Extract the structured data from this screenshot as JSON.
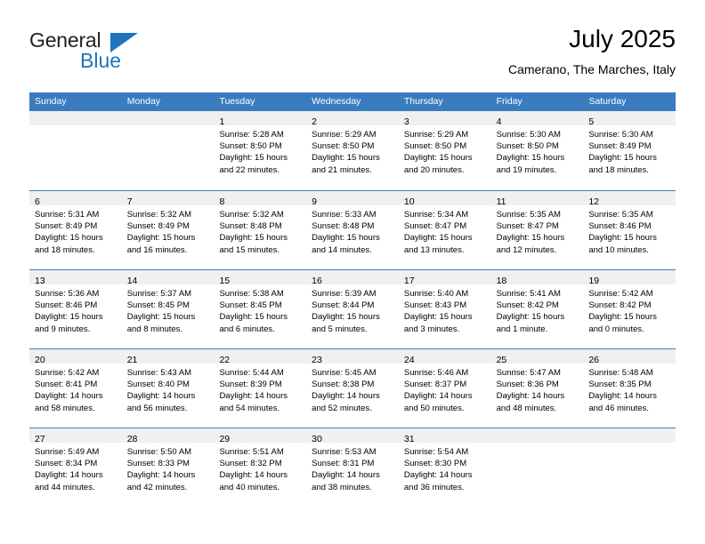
{
  "brand": {
    "name_top": "General",
    "name_bottom": "Blue",
    "triangle_color": "#1f74bd",
    "text_color": "#231f20"
  },
  "header": {
    "title": "July 2025",
    "subtitle": "Camerano, The Marches, Italy"
  },
  "theme": {
    "header_blue": "#3a7cbe",
    "day_band_gray": "#f0f0f0",
    "text_black": "#000000",
    "white": "#ffffff"
  },
  "weekdays": [
    "Sunday",
    "Monday",
    "Tuesday",
    "Wednesday",
    "Thursday",
    "Friday",
    "Saturday"
  ],
  "weeks": [
    [
      {
        "day": "",
        "lines": []
      },
      {
        "day": "",
        "lines": []
      },
      {
        "day": "1",
        "lines": [
          "Sunrise: 5:28 AM",
          "Sunset: 8:50 PM",
          "Daylight: 15 hours",
          "and 22 minutes."
        ]
      },
      {
        "day": "2",
        "lines": [
          "Sunrise: 5:29 AM",
          "Sunset: 8:50 PM",
          "Daylight: 15 hours",
          "and 21 minutes."
        ]
      },
      {
        "day": "3",
        "lines": [
          "Sunrise: 5:29 AM",
          "Sunset: 8:50 PM",
          "Daylight: 15 hours",
          "and 20 minutes."
        ]
      },
      {
        "day": "4",
        "lines": [
          "Sunrise: 5:30 AM",
          "Sunset: 8:50 PM",
          "Daylight: 15 hours",
          "and 19 minutes."
        ]
      },
      {
        "day": "5",
        "lines": [
          "Sunrise: 5:30 AM",
          "Sunset: 8:49 PM",
          "Daylight: 15 hours",
          "and 18 minutes."
        ]
      }
    ],
    [
      {
        "day": "6",
        "lines": [
          "Sunrise: 5:31 AM",
          "Sunset: 8:49 PM",
          "Daylight: 15 hours",
          "and 18 minutes."
        ]
      },
      {
        "day": "7",
        "lines": [
          "Sunrise: 5:32 AM",
          "Sunset: 8:49 PM",
          "Daylight: 15 hours",
          "and 16 minutes."
        ]
      },
      {
        "day": "8",
        "lines": [
          "Sunrise: 5:32 AM",
          "Sunset: 8:48 PM",
          "Daylight: 15 hours",
          "and 15 minutes."
        ]
      },
      {
        "day": "9",
        "lines": [
          "Sunrise: 5:33 AM",
          "Sunset: 8:48 PM",
          "Daylight: 15 hours",
          "and 14 minutes."
        ]
      },
      {
        "day": "10",
        "lines": [
          "Sunrise: 5:34 AM",
          "Sunset: 8:47 PM",
          "Daylight: 15 hours",
          "and 13 minutes."
        ]
      },
      {
        "day": "11",
        "lines": [
          "Sunrise: 5:35 AM",
          "Sunset: 8:47 PM",
          "Daylight: 15 hours",
          "and 12 minutes."
        ]
      },
      {
        "day": "12",
        "lines": [
          "Sunrise: 5:35 AM",
          "Sunset: 8:46 PM",
          "Daylight: 15 hours",
          "and 10 minutes."
        ]
      }
    ],
    [
      {
        "day": "13",
        "lines": [
          "Sunrise: 5:36 AM",
          "Sunset: 8:46 PM",
          "Daylight: 15 hours",
          "and 9 minutes."
        ]
      },
      {
        "day": "14",
        "lines": [
          "Sunrise: 5:37 AM",
          "Sunset: 8:45 PM",
          "Daylight: 15 hours",
          "and 8 minutes."
        ]
      },
      {
        "day": "15",
        "lines": [
          "Sunrise: 5:38 AM",
          "Sunset: 8:45 PM",
          "Daylight: 15 hours",
          "and 6 minutes."
        ]
      },
      {
        "day": "16",
        "lines": [
          "Sunrise: 5:39 AM",
          "Sunset: 8:44 PM",
          "Daylight: 15 hours",
          "and 5 minutes."
        ]
      },
      {
        "day": "17",
        "lines": [
          "Sunrise: 5:40 AM",
          "Sunset: 8:43 PM",
          "Daylight: 15 hours",
          "and 3 minutes."
        ]
      },
      {
        "day": "18",
        "lines": [
          "Sunrise: 5:41 AM",
          "Sunset: 8:42 PM",
          "Daylight: 15 hours",
          "and 1 minute."
        ]
      },
      {
        "day": "19",
        "lines": [
          "Sunrise: 5:42 AM",
          "Sunset: 8:42 PM",
          "Daylight: 15 hours",
          "and 0 minutes."
        ]
      }
    ],
    [
      {
        "day": "20",
        "lines": [
          "Sunrise: 5:42 AM",
          "Sunset: 8:41 PM",
          "Daylight: 14 hours",
          "and 58 minutes."
        ]
      },
      {
        "day": "21",
        "lines": [
          "Sunrise: 5:43 AM",
          "Sunset: 8:40 PM",
          "Daylight: 14 hours",
          "and 56 minutes."
        ]
      },
      {
        "day": "22",
        "lines": [
          "Sunrise: 5:44 AM",
          "Sunset: 8:39 PM",
          "Daylight: 14 hours",
          "and 54 minutes."
        ]
      },
      {
        "day": "23",
        "lines": [
          "Sunrise: 5:45 AM",
          "Sunset: 8:38 PM",
          "Daylight: 14 hours",
          "and 52 minutes."
        ]
      },
      {
        "day": "24",
        "lines": [
          "Sunrise: 5:46 AM",
          "Sunset: 8:37 PM",
          "Daylight: 14 hours",
          "and 50 minutes."
        ]
      },
      {
        "day": "25",
        "lines": [
          "Sunrise: 5:47 AM",
          "Sunset: 8:36 PM",
          "Daylight: 14 hours",
          "and 48 minutes."
        ]
      },
      {
        "day": "26",
        "lines": [
          "Sunrise: 5:48 AM",
          "Sunset: 8:35 PM",
          "Daylight: 14 hours",
          "and 46 minutes."
        ]
      }
    ],
    [
      {
        "day": "27",
        "lines": [
          "Sunrise: 5:49 AM",
          "Sunset: 8:34 PM",
          "Daylight: 14 hours",
          "and 44 minutes."
        ]
      },
      {
        "day": "28",
        "lines": [
          "Sunrise: 5:50 AM",
          "Sunset: 8:33 PM",
          "Daylight: 14 hours",
          "and 42 minutes."
        ]
      },
      {
        "day": "29",
        "lines": [
          "Sunrise: 5:51 AM",
          "Sunset: 8:32 PM",
          "Daylight: 14 hours",
          "and 40 minutes."
        ]
      },
      {
        "day": "30",
        "lines": [
          "Sunrise: 5:53 AM",
          "Sunset: 8:31 PM",
          "Daylight: 14 hours",
          "and 38 minutes."
        ]
      },
      {
        "day": "31",
        "lines": [
          "Sunrise: 5:54 AM",
          "Sunset: 8:30 PM",
          "Daylight: 14 hours",
          "and 36 minutes."
        ]
      },
      {
        "day": "",
        "lines": []
      },
      {
        "day": "",
        "lines": []
      }
    ]
  ]
}
